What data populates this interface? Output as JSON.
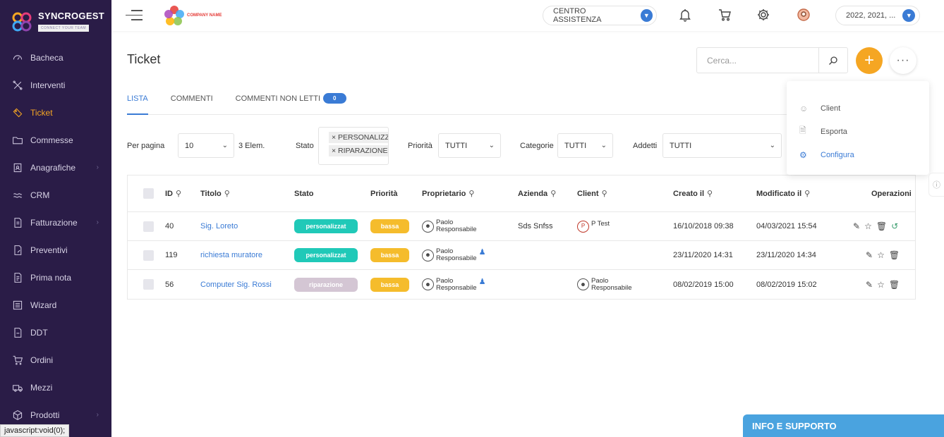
{
  "brand": {
    "name": "SYNCROGEST",
    "tagline": "CONNECT YOUR TEAM"
  },
  "sidebar": {
    "items": [
      {
        "label": "Bacheca",
        "icon": "gauge-icon"
      },
      {
        "label": "Interventi",
        "icon": "tools-icon"
      },
      {
        "label": "Ticket",
        "icon": "ticket-icon",
        "active": true
      },
      {
        "label": "Commesse",
        "icon": "folder-icon"
      },
      {
        "label": "Anagrafiche",
        "icon": "address-book-icon",
        "arrow": true
      },
      {
        "label": "CRM",
        "icon": "crm-icon"
      },
      {
        "label": "Fatturazione",
        "icon": "invoice-icon",
        "arrow": true
      },
      {
        "label": "Preventivi",
        "icon": "quote-icon"
      },
      {
        "label": "Prima nota",
        "icon": "notes-icon"
      },
      {
        "label": "Wizard",
        "icon": "wizard-icon"
      },
      {
        "label": "DDT",
        "icon": "ddt-icon"
      },
      {
        "label": "Ordini",
        "icon": "cart-icon"
      },
      {
        "label": "Mezzi",
        "icon": "truck-icon"
      },
      {
        "label": "Prodotti",
        "icon": "box-icon",
        "arrow": true
      }
    ],
    "status_url": "javascript:void(0);"
  },
  "topbar": {
    "company_name": "COMPANY NAME",
    "assistance": "CENTRO ASSISTENZA",
    "years": "2022, 2021, ..."
  },
  "page": {
    "title": "Ticket",
    "search_placeholder": "Cerca...",
    "add_label": "+",
    "more_label": "···"
  },
  "tabs": [
    {
      "label": "LISTA",
      "active": true
    },
    {
      "label": "COMMENTI"
    },
    {
      "label": "COMMENTI NON LETTI",
      "badge": "0"
    }
  ],
  "filters": {
    "per_page_label": "Per pagina",
    "per_page_value": "10",
    "elements": "3 Elem.",
    "stato_label": "Stato",
    "stato_tags": [
      "× PERSONALIZZATO",
      "× RIPARAZIONE"
    ],
    "priorita_label": "Priorità",
    "priorita_value": "TUTTI",
    "categorie_label": "Categorie",
    "categorie_value": "TUTTI",
    "addetti_label": "Addetti",
    "addetti_value": "TUTTI"
  },
  "table": {
    "headers": {
      "id": "ID",
      "titolo": "Titolo",
      "stato": "Stato",
      "priorita": "Priorità",
      "proprietario": "Proprietario",
      "azienda": "Azienda",
      "client": "Client",
      "creato": "Creato il",
      "modificato": "Modificato il",
      "operazioni": "Operazioni"
    },
    "rows": [
      {
        "id": "40",
        "titolo": "Sig. Loreto",
        "stato": "personalizzat",
        "stato_color": "teal",
        "priorita": "bassa",
        "owner_first": "Paolo",
        "owner_last": "Responsabile",
        "azienda": "Sds Snfss",
        "client": "P Test",
        "creato": "16/10/2018 09:38",
        "modificato": "04/03/2021 15:54"
      },
      {
        "id": "119",
        "titolo": "richiesta muratore",
        "stato": "personalizzat",
        "stato_color": "teal",
        "priorita": "bassa",
        "owner_first": "Paolo",
        "owner_last": "Responsabile",
        "azienda": "",
        "client": "",
        "creato": "23/11/2020 14:31",
        "modificato": "23/11/2020 14:34"
      },
      {
        "id": "56",
        "titolo": "Computer Sig. Rossi",
        "stato": "riparazione",
        "stato_color": "gray",
        "priorita": "bassa",
        "owner_first": "Paolo",
        "owner_last": "Responsabile",
        "azienda": "",
        "client_first": "Paolo",
        "client_last": "Responsabile",
        "creato": "08/02/2019 15:00",
        "modificato": "08/02/2019 15:02"
      }
    ]
  },
  "menu": {
    "items": [
      {
        "label": "Client",
        "icon": "user-icon"
      },
      {
        "label": "Esporta",
        "icon": "file-icon"
      },
      {
        "label": "Configura",
        "icon": "gear-icon"
      }
    ]
  },
  "support": {
    "label": "INFO E SUPPORTO"
  },
  "colors": {
    "sidebar": "#2a1c47",
    "accent": "#f5a623",
    "link": "#3a7bd5",
    "teal": "#20c9b8"
  }
}
